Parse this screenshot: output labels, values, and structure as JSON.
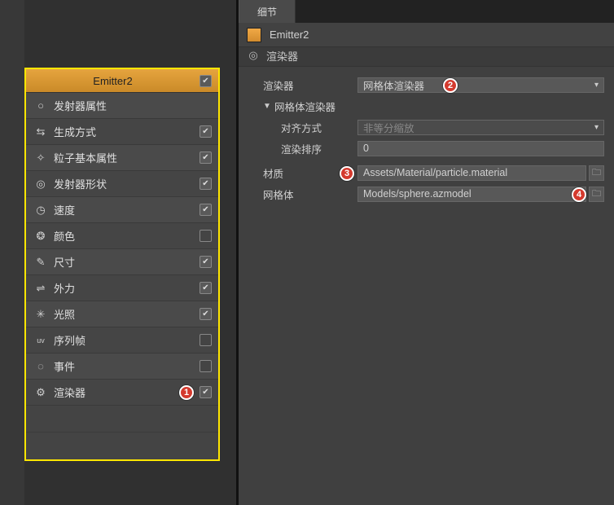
{
  "left": {
    "header": "Emitter2",
    "header_checked": true,
    "items": [
      {
        "icon": "circle-icon",
        "label": "发射器属性",
        "checked": null
      },
      {
        "icon": "arrows-icon",
        "label": "生成方式",
        "checked": true
      },
      {
        "icon": "spark-icon",
        "label": "粒子基本属性",
        "checked": true
      },
      {
        "icon": "pin-icon",
        "label": "发射器形状",
        "checked": true
      },
      {
        "icon": "speed-icon",
        "label": "速度",
        "checked": true
      },
      {
        "icon": "palette-icon",
        "label": "颜色",
        "checked": false
      },
      {
        "icon": "ruler-icon",
        "label": "尺寸",
        "checked": true
      },
      {
        "icon": "force-icon",
        "label": "外力",
        "checked": true
      },
      {
        "icon": "light-icon",
        "label": "光照",
        "checked": true
      },
      {
        "icon": "uv-icon",
        "label": "序列帧",
        "checked": false
      },
      {
        "icon": "event-icon",
        "label": "事件",
        "checked": false
      },
      {
        "icon": "gear-icon",
        "label": "渲染器",
        "checked": true
      }
    ]
  },
  "right": {
    "tab": "细节",
    "emitter_title": "Emitter2",
    "breadcrumb": "渲染器",
    "renderer_label": "渲染器",
    "renderer_value": "网格体渲染器",
    "mesh_section": "网格体渲染器",
    "align_label": "对齐方式",
    "align_value": "非等分缩放",
    "render_order_label": "渲染排序",
    "render_order_value": "0",
    "material_label": "材质",
    "material_value": "Assets/Material/particle.material",
    "mesh_label": "网格体",
    "mesh_value": "Models/sphere.azmodel"
  },
  "badges": {
    "b1": "1",
    "b2": "2",
    "b3": "3",
    "b4": "4"
  },
  "glyphs": {
    "circle-icon": "○",
    "arrows-icon": "⇆",
    "spark-icon": "✧",
    "pin-icon": "◎",
    "speed-icon": "◷",
    "palette-icon": "❂",
    "ruler-icon": "✎",
    "force-icon": "⇌",
    "light-icon": "✳",
    "uv-icon": "uv",
    "event-icon": "◌",
    "gear-icon": "⚙",
    "target-icon": "◎",
    "folder-icon": "🗀"
  }
}
